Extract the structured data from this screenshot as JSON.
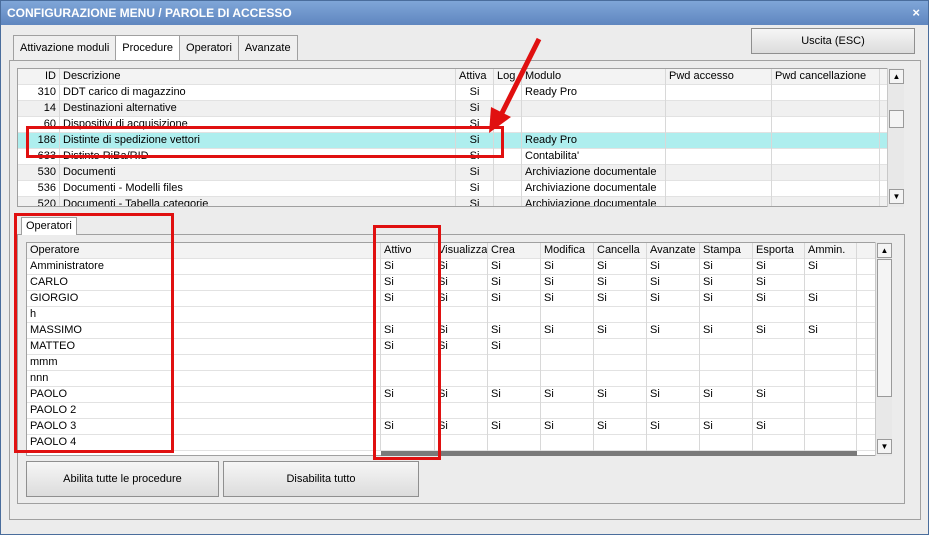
{
  "window": {
    "title": "CONFIGURAZIONE MENU / PAROLE DI ACCESSO",
    "close_label": "×"
  },
  "tabs": [
    {
      "label": "Attivazione moduli"
    },
    {
      "label": "Procedure"
    },
    {
      "label": "Operatori"
    },
    {
      "label": "Avanzate"
    }
  ],
  "exit_button": "Uscita (ESC)",
  "procedures": {
    "headers": {
      "id": "ID",
      "descrizione": "Descrizione",
      "attiva": "Attiva",
      "log": "Log",
      "modulo": "Modulo",
      "pwd_accesso": "Pwd accesso",
      "pwd_cancellazione": "Pwd cancellazione"
    },
    "rows": [
      {
        "id": "310",
        "descrizione": "DDT carico di magazzino",
        "attiva": "Si",
        "modulo": "Ready Pro"
      },
      {
        "id": "14",
        "descrizione": "Destinazioni alternative",
        "attiva": "Si",
        "modulo": ""
      },
      {
        "id": "60",
        "descrizione": "Dispositivi di acquisizione",
        "attiva": "Si",
        "modulo": ""
      },
      {
        "id": "186",
        "descrizione": "Distinte di spedizione vettori",
        "attiva": "Si",
        "modulo": "Ready Pro"
      },
      {
        "id": "633",
        "descrizione": "Distinte RiBa/RID",
        "attiva": "Si",
        "modulo": "Contabilita'"
      },
      {
        "id": "530",
        "descrizione": "Documenti",
        "attiva": "Si",
        "modulo": "Archiviazione documentale"
      },
      {
        "id": "536",
        "descrizione": "Documenti - Modelli files",
        "attiva": "Si",
        "modulo": "Archiviazione documentale"
      },
      {
        "id": "520",
        "descrizione": "Documenti - Tabella categorie",
        "attiva": "Si",
        "modulo": "Archiviazione documentale"
      }
    ]
  },
  "operators_tab": "Operatori",
  "operators": {
    "headers": {
      "operatore": "Operatore",
      "attivo": "Attivo",
      "visualizza": "Visualizza",
      "crea": "Crea",
      "modifica": "Modifica",
      "cancella": "Cancella",
      "avanzate": "Avanzate",
      "stampa": "Stampa",
      "esporta": "Esporta",
      "ammin": "Ammin."
    },
    "rows": [
      {
        "name": "Amministratore",
        "vals": [
          "Si",
          "Si",
          "Si",
          "Si",
          "Si",
          "Si",
          "Si",
          "Si",
          "Si"
        ]
      },
      {
        "name": "CARLO",
        "vals": [
          "Si",
          "Si",
          "Si",
          "Si",
          "Si",
          "Si",
          "Si",
          "Si",
          ""
        ]
      },
      {
        "name": "GIORGIO",
        "vals": [
          "Si",
          "Si",
          "Si",
          "Si",
          "Si",
          "Si",
          "Si",
          "Si",
          "Si"
        ]
      },
      {
        "name": "h",
        "vals": [
          "",
          "",
          "",
          "",
          "",
          "",
          "",
          "",
          ""
        ]
      },
      {
        "name": "MASSIMO",
        "vals": [
          "Si",
          "Si",
          "Si",
          "Si",
          "Si",
          "Si",
          "Si",
          "Si",
          "Si"
        ]
      },
      {
        "name": "MATTEO",
        "vals": [
          "Si",
          "Si",
          "Si",
          "",
          "",
          "",
          "",
          "",
          ""
        ]
      },
      {
        "name": "mmm",
        "vals": [
          "",
          "",
          "",
          "",
          "",
          "",
          "",
          "",
          ""
        ]
      },
      {
        "name": "nnn",
        "vals": [
          "",
          "",
          "",
          "",
          "",
          "",
          "",
          "",
          ""
        ]
      },
      {
        "name": "PAOLO",
        "vals": [
          "Si",
          "Si",
          "Si",
          "Si",
          "Si",
          "Si",
          "Si",
          "Si",
          ""
        ]
      },
      {
        "name": "PAOLO 2",
        "vals": [
          "",
          "",
          "",
          "",
          "",
          "",
          "",
          "",
          ""
        ]
      },
      {
        "name": "PAOLO 3",
        "vals": [
          "Si",
          "Si",
          "Si",
          "Si",
          "Si",
          "Si",
          "Si",
          "Si",
          ""
        ]
      },
      {
        "name": "PAOLO 4",
        "vals": [
          "",
          "",
          "",
          "",
          "",
          "",
          "",
          "",
          ""
        ]
      }
    ]
  },
  "buttons": {
    "enable_all": "Abilita tutte le procedure",
    "disable_all": "Disabilita tutto"
  },
  "colors": {
    "selection": "#aeeeee",
    "highlight": "#e01010",
    "title_bar": "#6a8fc7"
  }
}
